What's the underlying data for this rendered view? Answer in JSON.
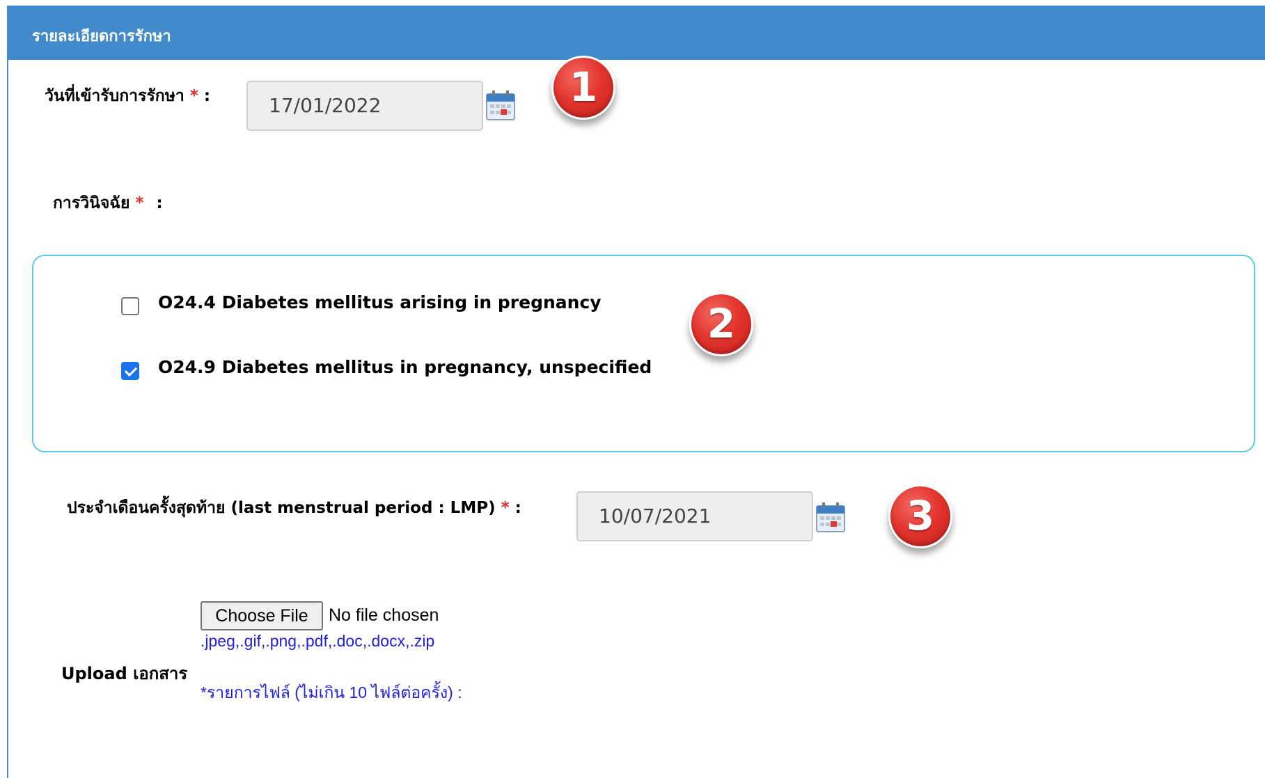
{
  "panel": {
    "title": "รายละเอียดการรักษา"
  },
  "admit_date": {
    "label": "วันที่เข้ารับการรักษา",
    "required_mark": "*",
    "colon": ":",
    "value": "17/01/2022",
    "calendar_icon": "calendar-icon"
  },
  "diagnosis": {
    "label": "การวินิจฉัย",
    "required_mark": "*",
    "colon": ":",
    "options": [
      {
        "label": "O24.4 Diabetes mellitus arising in pregnancy",
        "checked": false
      },
      {
        "label": "O24.9 Diabetes mellitus in pregnancy, unspecified",
        "checked": true
      }
    ]
  },
  "lmp": {
    "label": "ประจำเดือนครั้งสุดท้าย (last menstrual period : LMP)",
    "required_mark": "*",
    "colon": ":",
    "value": "10/07/2021",
    "calendar_icon": "calendar-icon"
  },
  "upload": {
    "label": "Upload เอกสาร",
    "button_label": "Choose File",
    "status": "No file chosen",
    "allowed_types": ".jpeg,.gif,.png,.pdf,.doc,.docx,.zip",
    "file_list_note": "*รายการไฟล์ (ไม่เกิน 10 ไฟล์ต่อครั้ง) :"
  },
  "markers": [
    "1",
    "2",
    "3"
  ],
  "colors": {
    "header_bg": "#428bca",
    "required": "#e0312f",
    "note_text": "#2222dd",
    "marker": "#e2352e",
    "diag_border": "#5bc9e8"
  }
}
